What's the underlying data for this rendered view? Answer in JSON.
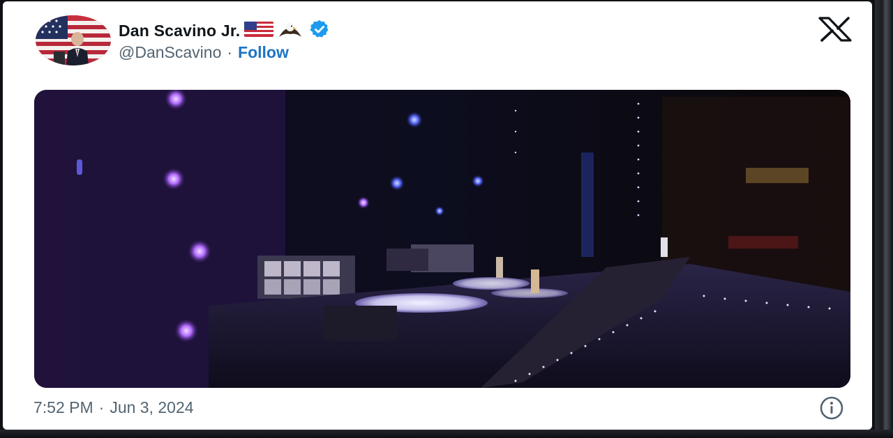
{
  "tweet": {
    "display_name": "Dan Scavino Jr.",
    "name_emoji": [
      "us-flag-icon",
      "eagle-icon"
    ],
    "verified": true,
    "handle": "@DanScavino",
    "separator": "·",
    "follow_label": "Follow",
    "time": "7:52 PM",
    "time_separator": "·",
    "date": "Jun 3, 2024",
    "media_description_icon": "concert-stage-video"
  },
  "icons": {
    "logo": "x-logo-icon",
    "info": "info-icon",
    "verified": "verified-badge-icon"
  },
  "colors": {
    "follow": "#1d74c4",
    "verified": "#1d9bf0",
    "muted_text": "#536471",
    "name_text": "#0f1419"
  }
}
